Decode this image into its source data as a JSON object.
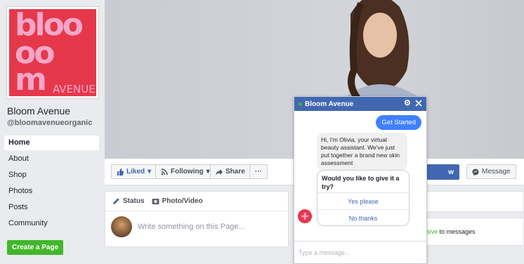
{
  "page": {
    "logo": {
      "line1": "bloo",
      "line2": "m",
      "word2": "AVENUE",
      "bg_color": "#e5384b",
      "text_color": "#f6a6c8"
    },
    "name": "Bloom Avenue",
    "handle": "@bloomavenueorganic"
  },
  "sidebar": {
    "items": [
      {
        "label": "Home",
        "active": true
      },
      {
        "label": "About"
      },
      {
        "label": "Shop"
      },
      {
        "label": "Photos"
      },
      {
        "label": "Posts"
      },
      {
        "label": "Community"
      }
    ],
    "create_label": "Create a Page"
  },
  "actions": {
    "liked": "Liked",
    "following": "Following",
    "share": "Share",
    "more": "···",
    "send_partial": "w",
    "message": "Message"
  },
  "composer": {
    "tab_status": "Status",
    "tab_photo": "Photo/Video",
    "placeholder": "Write something on this Page..."
  },
  "right": {
    "response_green": "sive",
    "response_rest": " to messages"
  },
  "chat": {
    "title": "Bloom Avenue",
    "outgoing": "Get Started",
    "incoming": "Hi, I'm Olivia, your virtual beauty assistant. We've just put together a brand new skin assessment",
    "question": "Would you like to give it a try?",
    "options": [
      "Yes please",
      "No thanks"
    ],
    "input_placeholder": "Type a message...",
    "accent": "#4267b2"
  }
}
